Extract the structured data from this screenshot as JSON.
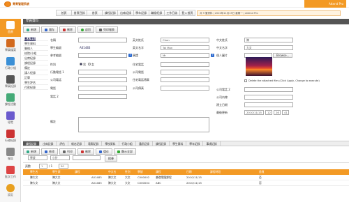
{
  "app": {
    "title": "青青管理系統",
    "user_info": "Attend Pro"
  },
  "menu": [
    "首頁",
    "首頁目錄",
    "首頁",
    "課程記錄",
    "出席記錄",
    "學年記錄",
    "職級紀錄",
    "工作日誌",
    "登入首頁"
  ],
  "infobar": "共 9 筆資料 | 2010年11月15日 星期一 | Attend Pro",
  "sidebar": [
    "首頁",
    "學員檔案",
    "行政小組",
    "學員記錄",
    "課程活動",
    "導覽",
    "行政紀錄",
    "報告",
    "批次工作",
    "設定"
  ],
  "panel_title": "學員資料",
  "toolbar": {
    "new": "新增",
    "save": "儲存",
    "delete": "刪除",
    "back": "返回",
    "print": "列印報表"
  },
  "leftnav": [
    "基本資料",
    "學生資料",
    "聯絡人",
    "校院/小組",
    "出席紀錄",
    "課程記錄",
    "備註",
    "請人紀錄",
    "訂單",
    "學生評估",
    "付款紀錄"
  ],
  "form": {
    "labels": {
      "name": "名稱",
      "student_no": "學生編號",
      "ref_no": "參考編號",
      "gender": "性別",
      "mobile": "行動電話 1",
      "company_phone": "公司電話",
      "phone": "電話",
      "phone2": "電話 2",
      "cn_name": "英文姓氏",
      "en_name": "英文名字",
      "category": "稱謂",
      "home_phone": "住宅電話",
      "company_phone2": "公司電話",
      "home_fax": "住宅電話傳真",
      "company_fax": "公司傳真",
      "cn_surname": "中文姓氏",
      "cn_given": "中文名字",
      "photo": "個人圖片",
      "company_phone3": "公司電話 2",
      "company_ext": "公司內線",
      "created": "建立日期",
      "last_update": "最後更新",
      "remarks": "備註"
    },
    "values": {
      "student_no": "A01483",
      "gender_m": "男",
      "gender_f": "女",
      "en_surname": "Chan",
      "en_given": "Tai Man",
      "salutation": "Mr",
      "cn_surname": "陳",
      "cn_given": "大文",
      "browse": "Browse...",
      "delete_photo": "Delete the attached files (Click Apply, Change to execute)",
      "last_update_date": "2010/11/15",
      "last_update_h": "12",
      "last_update_m": "26",
      "last_update_s": "41"
    }
  },
  "tabs": [
    "課程記錄",
    "出席記錄",
    "評估",
    "報名記錄",
    "電郵記錄",
    "學校資料",
    "行政小組",
    "通訊記錄",
    "課程記錄",
    "學生資料",
    "學年記錄",
    "事項記錄"
  ],
  "subtoolbar": {
    "new": "新增",
    "edit": "修改",
    "print": "列印",
    "delete": "刪除",
    "save": "儲存",
    "showall": "顯示全部"
  },
  "filter": {
    "field": "學號",
    "op": "小於",
    "value": "",
    "go": "搜尋"
  },
  "paging": {
    "label": "頁數",
    "page": "1",
    "of": "/ 1",
    "count": "50"
  },
  "grid": {
    "headers": [
      "",
      "學生名",
      "學生號",
      "課程",
      "",
      "中文名",
      "性別",
      "學號",
      "課程",
      "日期",
      "課程時段",
      "",
      "",
      "首頁"
    ],
    "rows": [
      [
        "",
        "陳大文",
        "陳大文",
        "",
        "A01483",
        "陳大文",
        "大文",
        "C000002",
        "基礎電腦課程",
        "2010/11/15",
        "",
        "",
        "",
        "否"
      ],
      [
        "",
        "陳大文",
        "陳大文",
        "",
        "A01483",
        "陳大文",
        "大文",
        "C000004",
        "ABC",
        "2010/11/15",
        "",
        "",
        "",
        "否"
      ]
    ]
  }
}
